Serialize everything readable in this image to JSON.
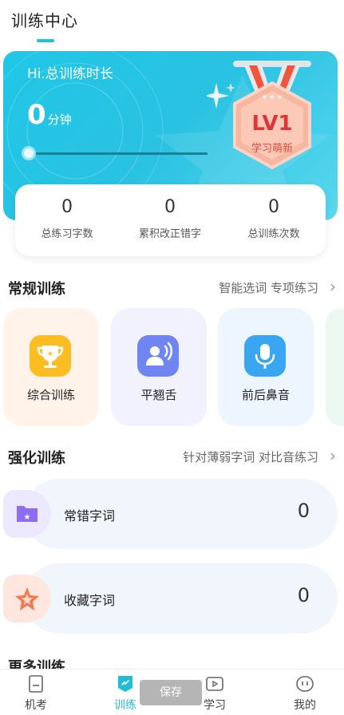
{
  "header": {
    "title": "训练中心"
  },
  "banner": {
    "greeting": "Hi.总训练时长",
    "time_value": "0",
    "time_unit": "分钟",
    "progress": 0,
    "medal": {
      "level": "LV1",
      "title": "学习萌新"
    }
  },
  "stats": [
    {
      "value": "0",
      "label": "总练习字数"
    },
    {
      "value": "0",
      "label": "累积改正错字"
    },
    {
      "value": "0",
      "label": "总训练次数"
    }
  ],
  "regular": {
    "title": "常规训练",
    "links": "智能选词 专项练习",
    "cards": [
      {
        "label": "综合训练",
        "icon": "trophy-icon",
        "bg": "#fff3ea",
        "icon_color": "#fbbd22"
      },
      {
        "label": "平翘舌",
        "icon": "speaker-person-icon",
        "bg": "#f1f2fd",
        "icon_color": "#6f86f2"
      },
      {
        "label": "前后鼻音",
        "icon": "microphone-icon",
        "bg": "#edf5ff",
        "icon_color": "#3aa6f2"
      }
    ]
  },
  "intensive": {
    "title": "强化训练",
    "links": "针对薄弱字词 对比音练习",
    "items": [
      {
        "label": "常错字词",
        "count": "0",
        "icon": "folder-star-icon",
        "icon_bg": "#ece8ff",
        "icon_color": "#8e6df1"
      },
      {
        "label": "收藏字词",
        "count": "0",
        "icon": "star-icon",
        "icon_bg": "#ffe6de",
        "icon_color": "#f07a52"
      }
    ]
  },
  "more": {
    "title": "更多训练"
  },
  "tabbar": {
    "tabs": [
      {
        "label": "机考",
        "icon": "exam-sheet-icon"
      },
      {
        "label": "训练",
        "icon": "training-badge-icon",
        "active": true
      },
      {
        "label": "学习",
        "icon": "play-video-icon"
      },
      {
        "label": "我的",
        "icon": "profile-face-icon"
      }
    ]
  },
  "toast": {
    "text": "保存"
  },
  "colors": {
    "accent": "#21c1d9",
    "medal_red": "#e0343a"
  }
}
